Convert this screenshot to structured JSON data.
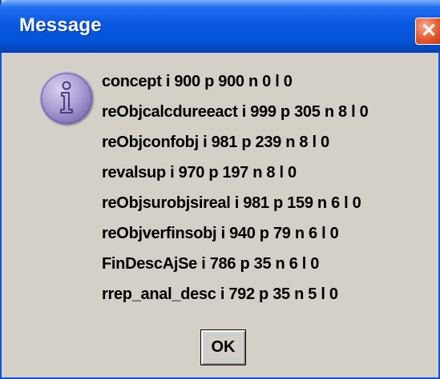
{
  "window": {
    "title": "Message",
    "close_glyph": "✕"
  },
  "icon": "info-icon",
  "lines": [
    "concept i 900 p 900 n 0 l 0",
    "reObjcalcdureeact i 999 p 305 n 8 l 0",
    "reObjconfobj i 981 p 239 n 8 l 0",
    "revalsup i 970 p 197 n 8 l 0",
    "reObjsurobjsireal i 981 p 159 n 6 l 0",
    "reObjverfinsobj i 940 p 79 n 6 l 0",
    "FinDescAjSe i 786 p 35 n 6 l 0",
    "rrep_anal_desc i 792 p 35 n 5 l 0"
  ],
  "buttons": {
    "ok_label": "OK"
  },
  "colors": {
    "titlebar": "#0a58e2",
    "dialog_bg": "#d4d0c8",
    "close_button": "#e55a2e",
    "icon": "#a99bd3"
  }
}
